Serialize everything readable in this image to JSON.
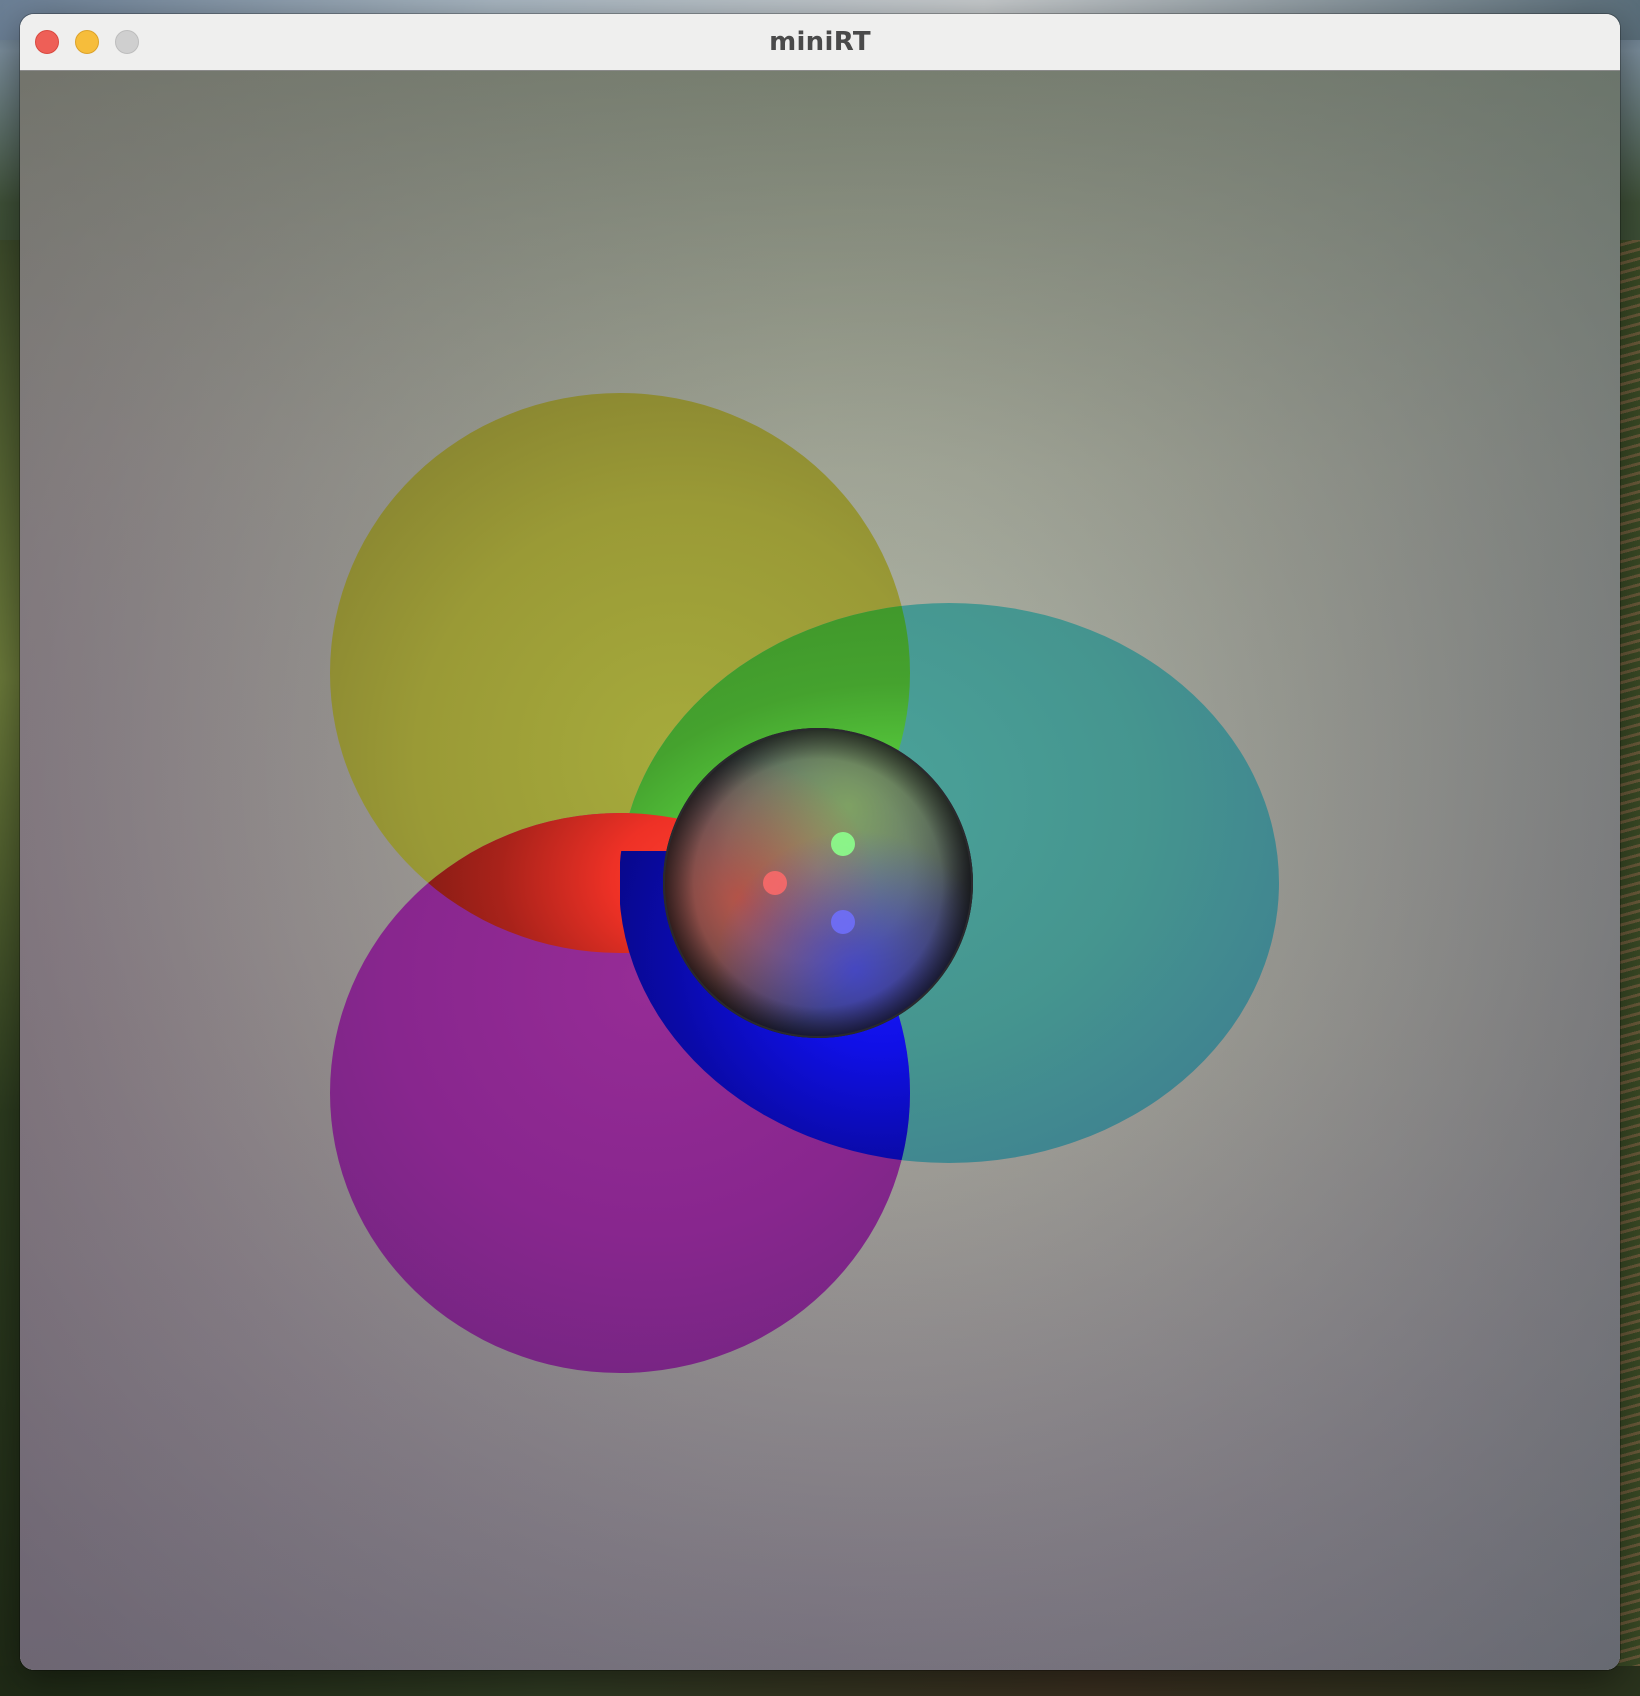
{
  "window": {
    "title": "miniRT",
    "controls": [
      "close",
      "minimize",
      "zoom"
    ]
  },
  "render": {
    "background": {
      "center_color": "#b5b3a8",
      "top_color": "#788070",
      "bottom_left_color": "#746874",
      "bottom_right_color": "#6c6e7e"
    },
    "objects": [
      {
        "name": "yellow-sphere",
        "color": "#9c9a32"
      },
      {
        "name": "cyan-sphere",
        "color": "#469a97"
      },
      {
        "name": "magenta-sphere",
        "color": "#8a2a92"
      },
      {
        "name": "green-light-glow",
        "color": "#66ff55"
      },
      {
        "name": "red-light-glow",
        "color": "#ff3a2a"
      },
      {
        "name": "blue-light-glow",
        "color": "#1a1aff"
      },
      {
        "name": "center-glass-sphere",
        "color": "#5f6d72"
      }
    ],
    "lights": [
      {
        "name": "red-light",
        "color": "#ff6666"
      },
      {
        "name": "green-light",
        "color": "#88ff88"
      },
      {
        "name": "blue-light",
        "color": "#7777ff"
      }
    ]
  }
}
